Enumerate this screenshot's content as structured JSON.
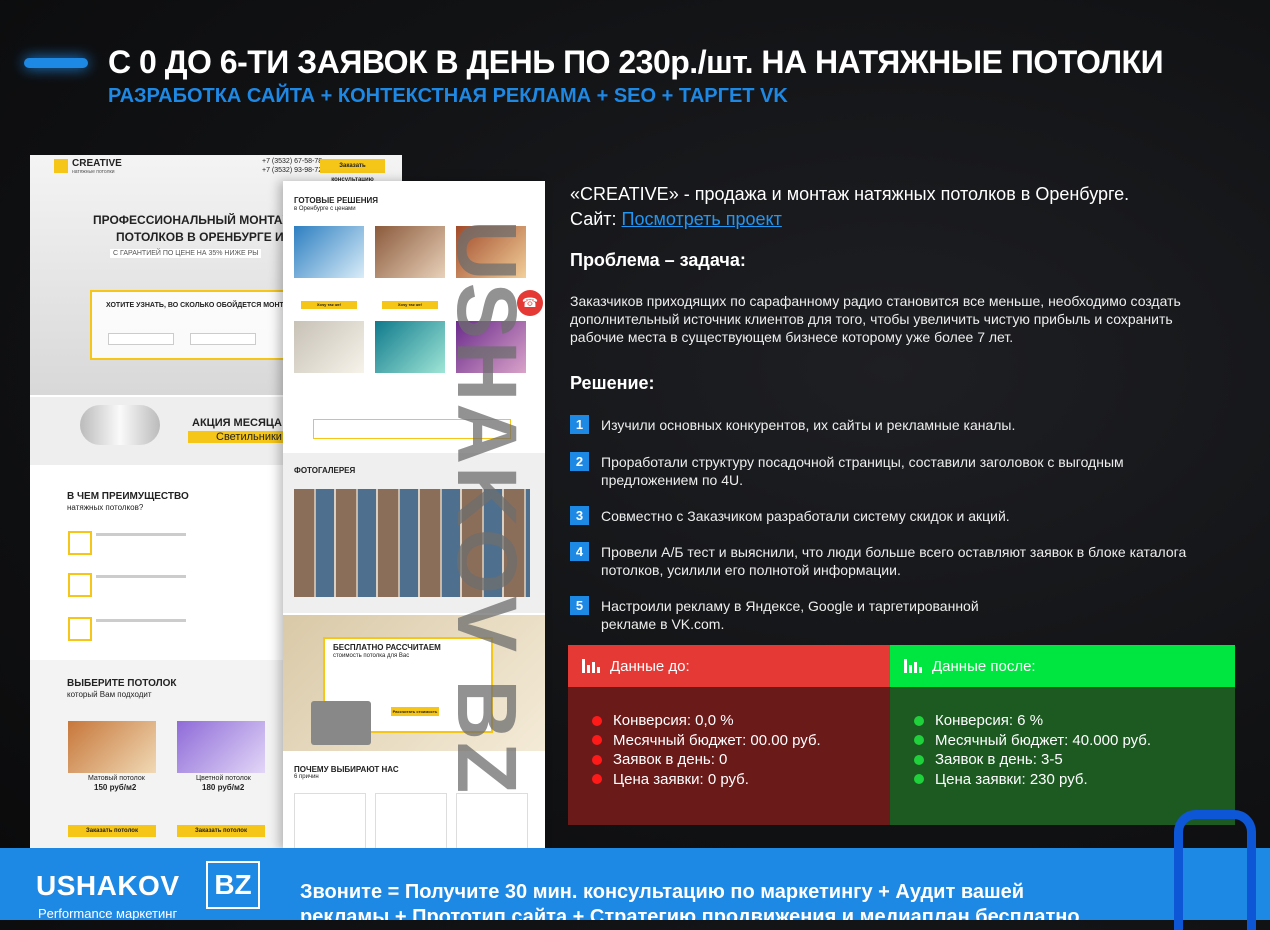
{
  "header": {
    "title": "С 0 ДО 6-ТИ ЗАЯВОК В ДЕНЬ ПО 230р./шт. НА НАТЯЖНЫЕ ПОТОЛКИ",
    "subtitle": "РАЗРАБОТКА САЙТА + КОНТЕКСТНАЯ РЕКЛАМА + SEO + ТАРГЕТ VK"
  },
  "mockup": {
    "brand": "CREATIVE",
    "brand_sub": "натяжные потолки",
    "phones": [
      "+7 (3532) 67-58-78",
      "+7 (3532) 93-98-72"
    ],
    "order_btn": "Заказать консультацию",
    "hero_line1": "ПРОФЕССИОНАЛЬНЫЙ МОНТАЖ НА",
    "hero_line2": "ПОТОЛКОВ В ОРЕНБУРГЕ И ОБ",
    "guarantee": "С ГАРАНТИЕЙ ПО ЦЕНЕ НА 35% НИЖЕ РЫ",
    "question": "ХОТИТЕ УЗНАТЬ, ВО СКОЛЬКО ОБОЙДЕТСЯ МОНТА",
    "promo_title": "АКЦИЯ МЕСЯЦА",
    "promo_sub": "Светильники",
    "advantages_title": "В ЧЕМ ПРЕИМУЩЕСТВО",
    "advantages_sub": "натяжных потолков?",
    "choose_title": "ВЫБЕРИТЕ ПОТОЛОК",
    "choose_sub": "который Вам подходит",
    "card1_title": "Матовый потолок",
    "card1_price": "150 руб/м2",
    "card2_title": "Цветной потолок",
    "card2_price": "180 руб/м2",
    "card_btn": "Заказать потолок",
    "ready_title": "ГОТОВЫЕ РЕШЕНИЯ",
    "ready_sub": "в Оренбурге с ценами",
    "catalog_btn": "Хочу так же!",
    "gallery_title": "ФОТОГАЛЕРЕЯ",
    "free_title": "БЕСПЛАТНО РАССЧИТАЕМ",
    "free_sub": "стоимость потолка для Вас",
    "free_btn": "Рассчитать стоимость",
    "why_title": "ПОЧЕМУ ВЫБИРАЮТ НАС",
    "why_sub": "6 причин",
    "watermark": "USHAKOV BZ"
  },
  "project": {
    "intro": "«CREATIVE» - продажа и монтаж натяжных потолков в Оренбурге.",
    "site_label": "Сайт:",
    "site_link": "Посмотреть проект",
    "problem_title": "Проблема – задача:",
    "problem_text": "Заказчиков приходящих по сарафанному радио становится все меньше, необходимо создать дополнительный источник клиентов для того, чтобы увеличить чистую прибыль и сохранить рабочие места в существующем бизнесе которому уже более 7 лет.",
    "solution_title": "Решение:",
    "steps": [
      {
        "n": "1",
        "text": "Изучили основных конкурентов, их сайты и рекламные каналы."
      },
      {
        "n": "2",
        "text": "Проработали структуру посадочной страницы, составили заголовок с выгодным предложением по 4U."
      },
      {
        "n": "3",
        "text": "Совместно с Заказчиком разработали систему скидок и акций."
      },
      {
        "n": "4",
        "text": "Провели А/Б тест и выяснили, что люди больше всего оставляют заявок в блоке каталога потолков, усилили его полнотой информации."
      },
      {
        "n": "5",
        "text": "Настроили рекламу в Яндексе, Google и таргетированной рекламе в VK.com."
      }
    ]
  },
  "before": {
    "label": "Данные до:",
    "items": [
      "Конверсия: 0,0 %",
      "Месячный бюджет: 00.00 руб.",
      "Заявок в день: 0",
      "Цена заявки: 0 руб."
    ]
  },
  "after": {
    "label": "Данные после:",
    "items": [
      "Конверсия: 6 %",
      "Месячный бюджет: 40.000 руб.",
      "Заявок в день: 3-5",
      "Цена заявки: 230 руб."
    ]
  },
  "footer": {
    "logo": "USHAKOV",
    "logo_bz": "BZ",
    "logo_sub": "Performance маркетинг",
    "text": "Звоните = Получите 30 мин. консультацию по маркетингу + Аудит вашей рекламы + Прототип сайта + Стратегию продвижения и медиаплан бесплатно"
  },
  "colors": {
    "accent": "#1e88e5",
    "before_head": "#e53935",
    "before_body": "#6b1a1a",
    "after_head": "#00e640",
    "after_body": "#1c5a22",
    "promo_yellow": "#f5c518"
  }
}
